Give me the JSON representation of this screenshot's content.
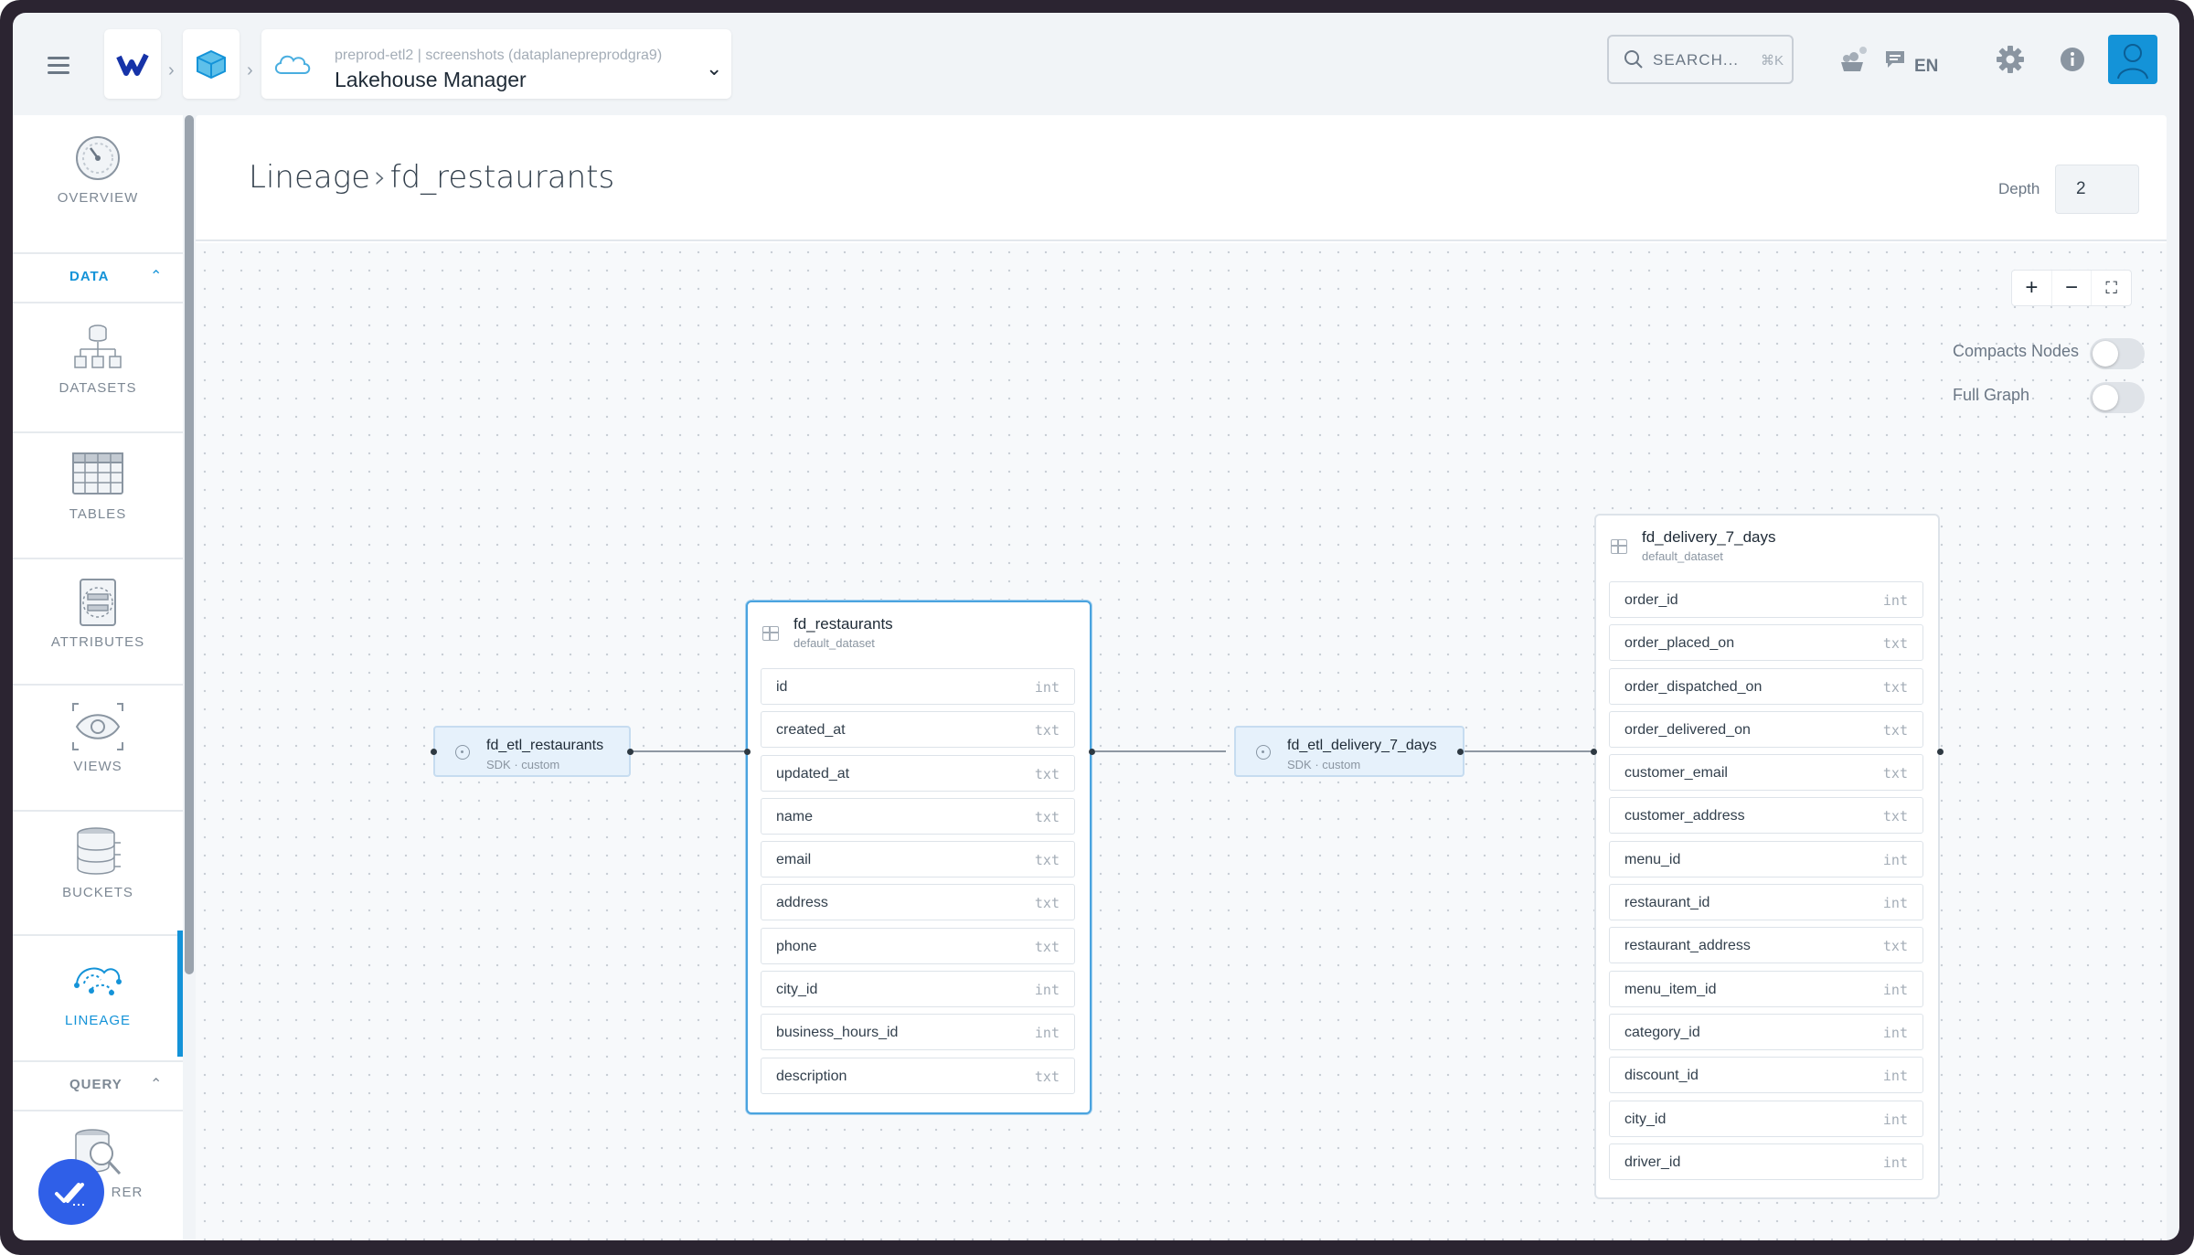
{
  "topbar": {
    "breadcrumb_sub": "preprod-etl2 | screenshots (dataplanepreprodgra9)",
    "breadcrumb_main": "Lakehouse Manager",
    "search_label": "SEARCH...",
    "search_shortcut": "⌘K",
    "language": "EN"
  },
  "sidebar": {
    "overview_label": "OVERVIEW",
    "data_section_label": "DATA",
    "datasets_label": "DATASETS",
    "tables_label": "TABLES",
    "attributes_label": "ATTRIBUTES",
    "views_label": "VIEWS",
    "buckets_label": "BUCKETS",
    "lineage_label": "LINEAGE",
    "query_section_label": "QUERY",
    "explorer_label": "RER",
    "accent_color": "#1493d8"
  },
  "page": {
    "title_root": "Lineage",
    "title_current": "fd_restaurants",
    "depth_label": "Depth",
    "depth_value": "2"
  },
  "graph_controls": {
    "zoom_in": "+",
    "zoom_out": "−",
    "fit": "⛶",
    "compact_nodes_label": "Compacts Nodes",
    "compact_nodes_on": false,
    "full_graph_label": "Full Graph",
    "full_graph_on": false
  },
  "nodes": {
    "etl_restaurants": {
      "name": "fd_etl_restaurants",
      "subtitle": "SDK · custom"
    },
    "restaurants": {
      "name": "fd_restaurants",
      "subtitle": "default_dataset",
      "columns": [
        {
          "name": "id",
          "type": "int"
        },
        {
          "name": "created_at",
          "type": "txt"
        },
        {
          "name": "updated_at",
          "type": "txt"
        },
        {
          "name": "name",
          "type": "txt"
        },
        {
          "name": "email",
          "type": "txt"
        },
        {
          "name": "address",
          "type": "txt"
        },
        {
          "name": "phone",
          "type": "txt"
        },
        {
          "name": "city_id",
          "type": "int"
        },
        {
          "name": "business_hours_id",
          "type": "int"
        },
        {
          "name": "description",
          "type": "txt"
        }
      ]
    },
    "etl_delivery": {
      "name": "fd_etl_delivery_7_days",
      "subtitle": "SDK · custom"
    },
    "delivery": {
      "name": "fd_delivery_7_days",
      "subtitle": "default_dataset",
      "columns": [
        {
          "name": "order_id",
          "type": "int"
        },
        {
          "name": "order_placed_on",
          "type": "txt"
        },
        {
          "name": "order_dispatched_on",
          "type": "txt"
        },
        {
          "name": "order_delivered_on",
          "type": "txt"
        },
        {
          "name": "customer_email",
          "type": "txt"
        },
        {
          "name": "customer_address",
          "type": "txt"
        },
        {
          "name": "menu_id",
          "type": "int"
        },
        {
          "name": "restaurant_id",
          "type": "int"
        },
        {
          "name": "restaurant_address",
          "type": "txt"
        },
        {
          "name": "menu_item_id",
          "type": "int"
        },
        {
          "name": "category_id",
          "type": "int"
        },
        {
          "name": "discount_id",
          "type": "int"
        },
        {
          "name": "city_id",
          "type": "int"
        },
        {
          "name": "driver_id",
          "type": "int"
        }
      ]
    }
  }
}
